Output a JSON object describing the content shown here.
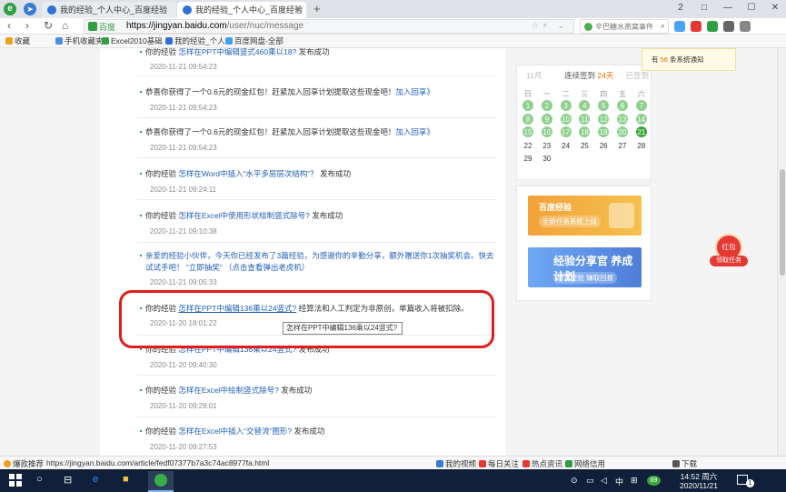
{
  "browser": {
    "tabs": [
      {
        "title": "我的经验_个人中心_百度经验"
      },
      {
        "title": "我的经验_个人中心_百度经验"
      }
    ],
    "new_tab": "+",
    "tab_counter": "2",
    "window_controls": [
      "□",
      "—",
      "☐",
      "✕"
    ]
  },
  "address": {
    "site_label": "百度",
    "url_host": "https://jingyan.baidu.com",
    "url_path": "/user/nuc/message",
    "search_placeholder": "辛巴糖水燕窝事件"
  },
  "bookmarks": [
    {
      "label": "收藏",
      "color": "#f0a020"
    },
    {
      "label": "手机收藏夹",
      "color": "#4a90e2"
    },
    {
      "label": "Excel2010基础",
      "color": "#2ea043"
    },
    {
      "label": "我的经验_个人",
      "color": "#2f6fd6"
    },
    {
      "label": "百度网盘-全部",
      "color": "#3ea0f0"
    }
  ],
  "messages": [
    {
      "prefix": "你的经验 ",
      "link": "怎样在PPT中编辑竖式460乘以18?",
      "suffix": " 发布成功",
      "date": "2020-11-21 09:54:23"
    },
    {
      "prefix": "恭喜你获得了一个0.6元的现金红包！赶紧加入回享计划提取这些现金吧！",
      "link": "加入回享》",
      "suffix": "",
      "date": "2020-11-21 09:54:23"
    },
    {
      "prefix": "恭喜你获得了一个0.6元的现金红包！赶紧加入回享计划提取这些现金吧！",
      "link": "加入回享》",
      "suffix": "",
      "date": "2020-11-21 09:54:23"
    },
    {
      "prefix": "你的经验 ",
      "link": "怎样在Word中插入“水平多层层次结构”？",
      "suffix": " 发布成功",
      "date": "2020-11-21 09:24:11"
    },
    {
      "prefix": "你的经验 ",
      "link": "怎样在Excel中使用形状绘制竖式除号?",
      "suffix": " 发布成功",
      "date": "2020-11-21 09:10:38"
    },
    {
      "prefix": "",
      "link": "亲爱的经验小伙伴，今天你已经发布了3篇经验，为感谢你的辛勤分享，额外赠送你1次抽奖机会。快去试试手吧！ “立即抽奖” （点击查看弹出老虎机）",
      "suffix": "",
      "date": "2020-11-21 09:05:33"
    },
    {
      "prefix": "你的经验 ",
      "link": "怎样在PPT中编辑136乘以24竖式?",
      "suffix": " 经算法和人工判定为非原创，单篇收入将被扣除。",
      "date": "2020-11-20 18:01:22"
    },
    {
      "prefix": "你的经验 ",
      "link": "怎样在PPT中编辑136乘以24竖式?",
      "suffix": " 发布成功",
      "date": "2020-11-20 09:40:30"
    },
    {
      "prefix": "你的经验 ",
      "link": "怎样在Excel中绘制竖式除号?",
      "suffix": " 发布成功",
      "date": "2020-11-20 09:28:01"
    },
    {
      "prefix": "你的经验 ",
      "link": "怎样在Excel中插入“交替流”图形?",
      "suffix": " 发布成功",
      "date": "2020-11-20 09:27:53"
    }
  ],
  "tooltip": "怎样在PPT中编辑136乘以24竖式?",
  "calendar": {
    "month": "11月",
    "streak_prefix": "连续签到 ",
    "streak_days": "24天",
    "signed_label": "已签到",
    "weekdays": [
      "日",
      "一",
      "二",
      "三",
      "四",
      "五",
      "六"
    ],
    "days": [
      "1",
      "2",
      "3",
      "4",
      "5",
      "6",
      "7",
      "8",
      "9",
      "10",
      "11",
      "12",
      "13",
      "14",
      "15",
      "16",
      "17",
      "18",
      "19",
      "20",
      "21",
      "22",
      "23",
      "24",
      "25",
      "26",
      "27",
      "28",
      "29",
      "30"
    ],
    "signed_until": 21,
    "today": 21
  },
  "banners": [
    {
      "title": "百度经验",
      "subtitle": "全新任务系统上线"
    },
    {
      "title": "经验分享官 养成计划",
      "subtitle": "分享经验 赚取回报"
    }
  ],
  "notify": {
    "prefix": "有 ",
    "count": "56",
    "suffix": " 条系统通知"
  },
  "hongbao": {
    "label": "红包",
    "button": "领取任务"
  },
  "statusbar": {
    "left": "爆款推荐",
    "url": "https://jingyan.baidu.com/article/fedf07377b7a3c74ac8977fa.html",
    "items": [
      {
        "label": "我的视频",
        "color": "#3a7bd5"
      },
      {
        "label": "每日关注",
        "color": "#e53935"
      },
      {
        "label": "热点资讯",
        "color": "#e53935"
      },
      {
        "label": "网络信用",
        "color": "#2ea043"
      },
      {
        "label": "下载",
        "color": "#555555"
      }
    ]
  },
  "taskbar": {
    "time": "14:52 周六",
    "date": "2020/11/21",
    "ime": "中",
    "badge": "69",
    "notify_count": "1"
  }
}
